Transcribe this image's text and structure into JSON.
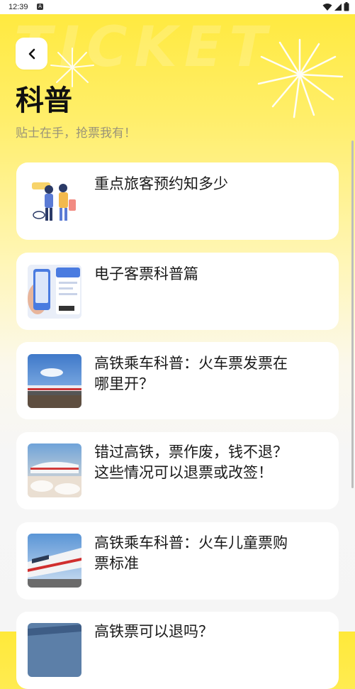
{
  "status_bar": {
    "time": "12:39",
    "notification_glyph": "A"
  },
  "header": {
    "watermark": "TICKET",
    "title": "科普",
    "subtitle": "贴士在手，抢票我有！"
  },
  "articles": [
    {
      "title_lines": [
        "重点旅客预约知多少"
      ],
      "thumb": "travelers-illustration"
    },
    {
      "title_lines": [
        "电子客票科普篇"
      ],
      "thumb": "e-ticket-phone"
    },
    {
      "title_lines": [
        "高铁乘车科普：火车票发票在",
        "哪里开？"
      ],
      "thumb": "train-on-bridge"
    },
    {
      "title_lines": [
        "错过高铁，票作废，钱不退？",
        "这些情况可以退票或改签！"
      ],
      "thumb": "train-at-station"
    },
    {
      "title_lines": [
        "高铁乘车科普：火车儿童票购",
        "票标准"
      ],
      "thumb": "high-speed-train"
    },
    {
      "title_lines": [
        "高铁票可以退吗？"
      ],
      "thumb": "train-partial"
    }
  ],
  "colors": {
    "accent": "#FFE93A",
    "card": "#FFFFFF",
    "text": "#1A1A1A",
    "subtitle": "#9A9478"
  }
}
